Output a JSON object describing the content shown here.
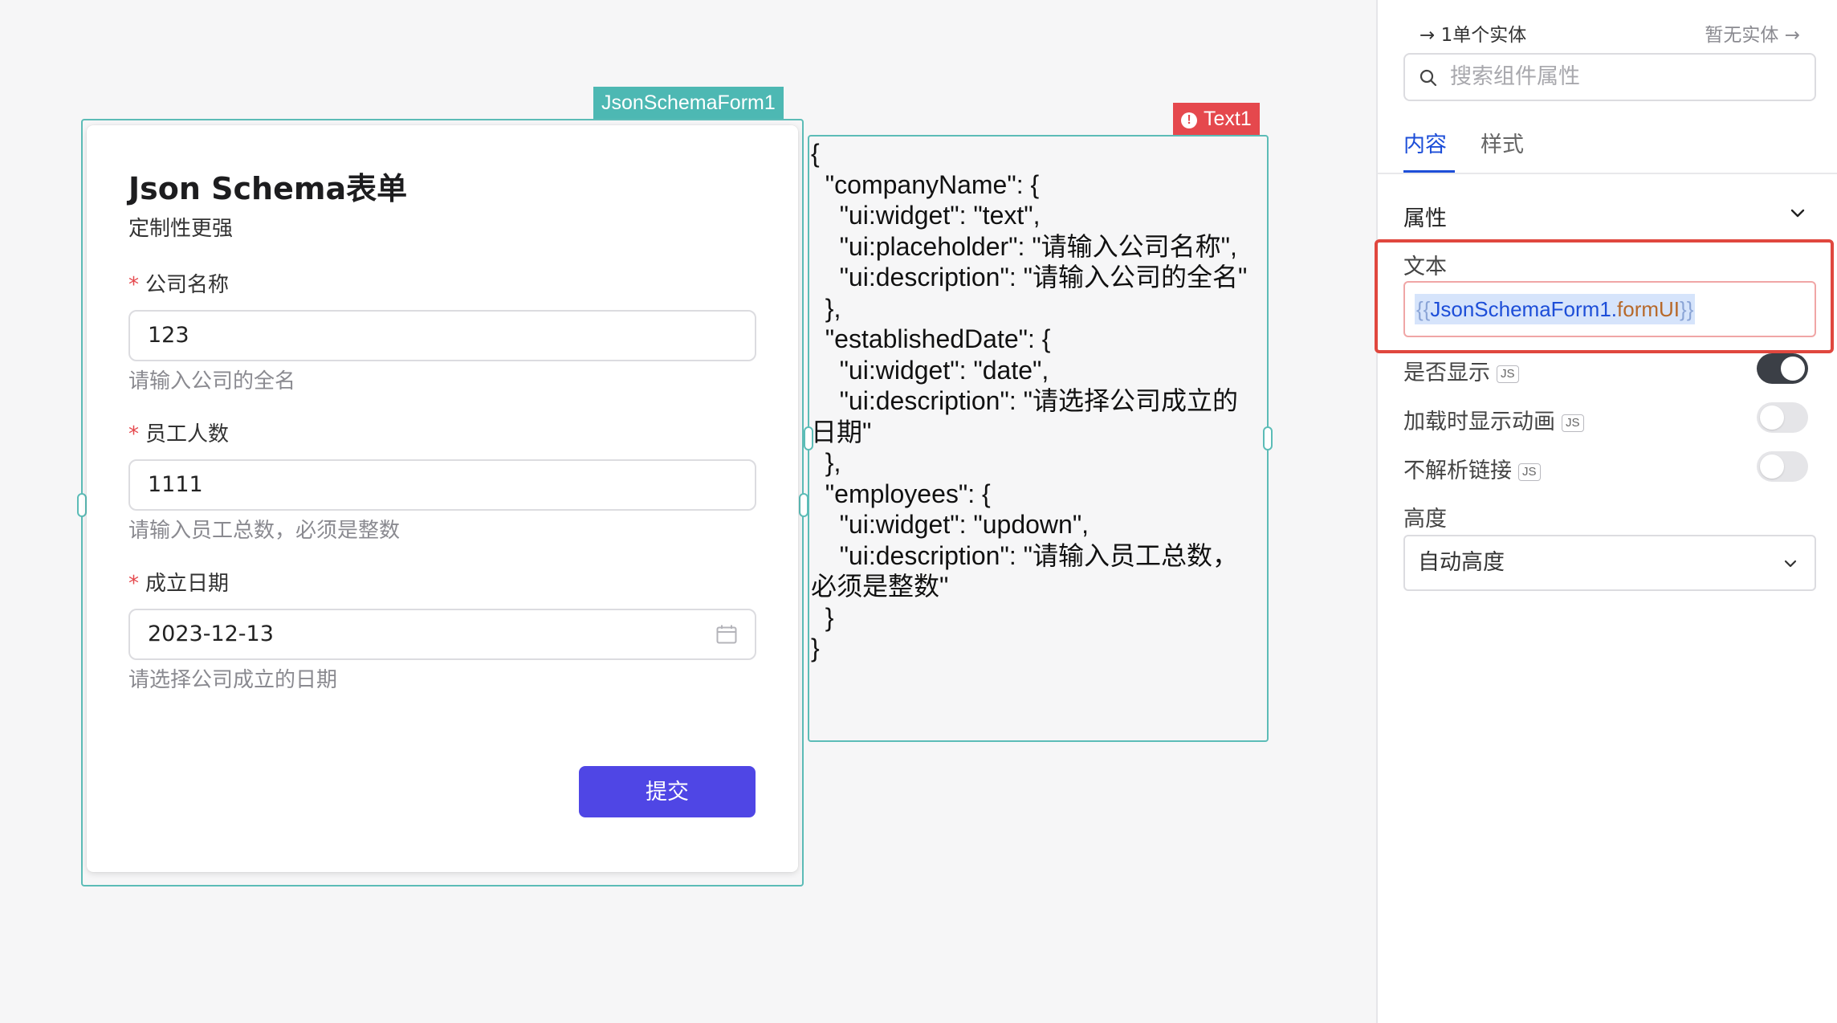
{
  "canvas": {
    "form_component": {
      "tag": "JsonSchemaForm1",
      "title": "Json Schema表单",
      "subtitle": "定制性更强",
      "fields": [
        {
          "label": "公司名称",
          "required": true,
          "value": "123",
          "description": "请输入公司的全名"
        },
        {
          "label": "员工人数",
          "required": true,
          "value": "1111",
          "description": "请输入员工总数，必须是整数"
        },
        {
          "label": "成立日期",
          "required": true,
          "value": "2023-12-13",
          "description": "请选择公司成立的日期",
          "icon": "calendar-icon"
        }
      ],
      "required_mark": "*",
      "submit_label": "提交",
      "accent_color": "#4f46e5",
      "frame_color": "#5cbcb7"
    },
    "text_component": {
      "tag": "Text1",
      "tag_color": "#e5484d",
      "alert_icon": "!",
      "content": "{\n  \"companyName\": {\n    \"ui:widget\": \"text\",\n    \"ui:placeholder\": \"请输入公司名称\",\n    \"ui:description\": \"请输入公司的全名\"\n  },\n  \"establishedDate\": {\n    \"ui:widget\": \"date\",\n    \"ui:description\": \"请选择公司成立的日期\"\n  },\n  \"employees\": {\n    \"ui:widget\": \"updown\",\n    \"ui:description\": \"请输入员工总数，必须是整数\"\n  }\n}"
    }
  },
  "panel": {
    "nav": {
      "left_arrow": "→",
      "left_label": "1单个实体",
      "right_label": "暂无实体",
      "right_arrow": "→"
    },
    "search": {
      "placeholder": "搜索组件属性"
    },
    "tabs": [
      {
        "label": "内容",
        "active": true
      },
      {
        "label": "样式",
        "active": false
      }
    ],
    "section_title": "属性",
    "text_property": {
      "label": "文本",
      "value_open": "{{",
      "value_object": "JsonSchemaForm1",
      "value_dot": ".",
      "value_prop": "formUI",
      "value_close": "}}",
      "highlight_color": "#e0473e"
    },
    "toggles": [
      {
        "label": "是否显示",
        "badge": "JS",
        "on": true
      },
      {
        "label": "加载时显示动画",
        "badge": "JS",
        "on": false
      },
      {
        "label": "不解析链接",
        "badge": "JS",
        "on": false
      }
    ],
    "height": {
      "label": "高度",
      "value": "自动高度"
    }
  }
}
